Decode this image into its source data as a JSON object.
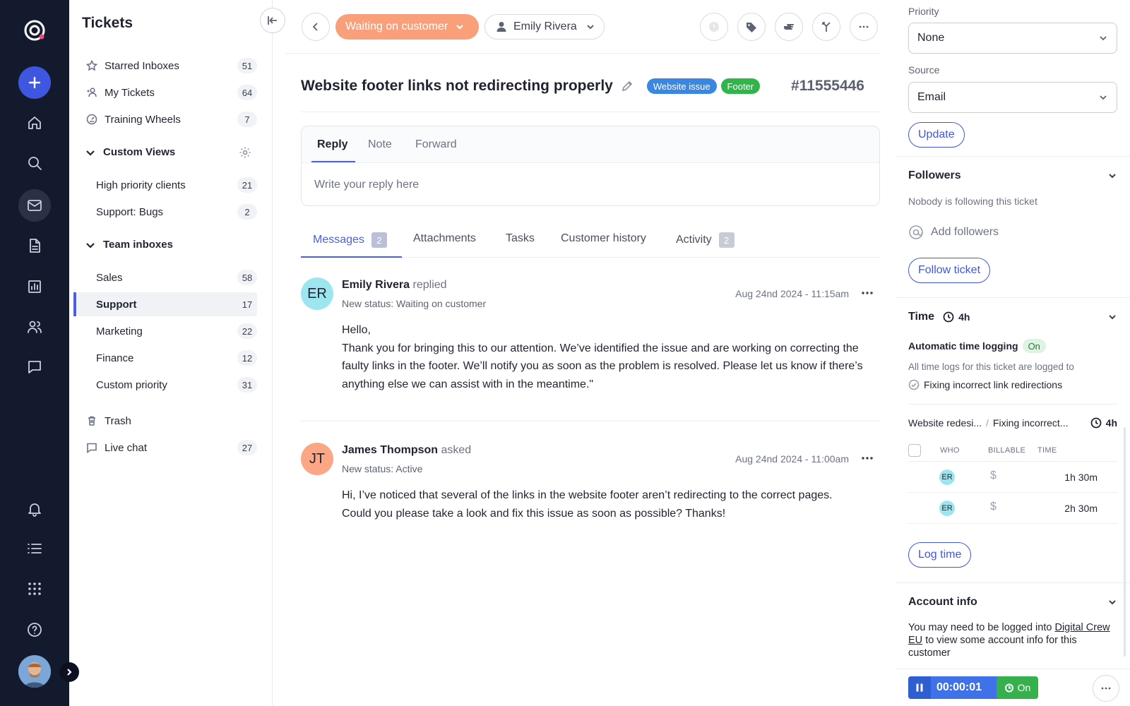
{
  "sidebar": {
    "title": "Tickets",
    "items": [
      {
        "label": "Starred Inboxes",
        "count": "51",
        "icon": "star-icon"
      },
      {
        "label": "My Tickets",
        "count": "64",
        "icon": "user-icon"
      },
      {
        "label": "Training Wheels",
        "count": "7",
        "icon": "gauge-icon"
      }
    ],
    "custom_views": {
      "label": "Custom Views",
      "items": [
        {
          "label": "High priority clients",
          "count": "21"
        },
        {
          "label": "Support: Bugs",
          "count": "2"
        }
      ]
    },
    "team_inboxes": {
      "label": "Team inboxes",
      "items": [
        {
          "label": "Sales",
          "count": "58"
        },
        {
          "label": "Support",
          "count": "17"
        },
        {
          "label": "Marketing",
          "count": "22"
        },
        {
          "label": "Finance",
          "count": "12"
        },
        {
          "label": "Custom priority",
          "count": "31"
        }
      ]
    },
    "bottom_items": [
      {
        "label": "Trash",
        "icon": "trash-icon"
      },
      {
        "label": "Live chat",
        "count": "27",
        "icon": "chat-icon"
      }
    ]
  },
  "topbar": {
    "status": "Waiting on customer",
    "assignee": "Emily Rivera"
  },
  "ticket": {
    "title": "Website footer links not redirecting properly",
    "tags": [
      "Website issue",
      "Footer"
    ],
    "id": "#11555446"
  },
  "reply": {
    "tabs": [
      "Reply",
      "Note",
      "Forward"
    ],
    "placeholder": "Write your reply here"
  },
  "message_tabs": [
    {
      "label": "Messages",
      "badge": "2"
    },
    {
      "label": "Attachments"
    },
    {
      "label": "Tasks"
    },
    {
      "label": "Customer history"
    },
    {
      "label": "Activity",
      "badge": "2"
    }
  ],
  "messages": [
    {
      "initials": "ER",
      "name": "Emily Rivera",
      "verb": "replied",
      "status": "New status: Waiting on customer",
      "date": "Aug 24nd 2024 - 11:15am",
      "body": [
        "Hello,",
        "Thank you for bringing this to our attention. We’ve identified the issue and are working on correcting the faulty links in the footer. We’ll notify you as soon as the problem is resolved. Please let us know if there’s anything else we can assist with in the meantime.\""
      ],
      "avatar_color": "#9ee6ef"
    },
    {
      "initials": "JT",
      "name": "James Thompson",
      "verb": "asked",
      "status": "New status: Active",
      "date": "Aug 24nd 2024 - 11:00am",
      "body": [
        "Hi, I’ve noticed that several of the links in the website footer aren’t redirecting to the correct pages. Could you please take a look and fix this issue as soon as possible? Thanks!"
      ],
      "avatar_color": "#fba786"
    }
  ],
  "right_panel": {
    "priority_label": "Priority",
    "priority_value": "None",
    "source_label": "Source",
    "source_value": "Email",
    "update_button": "Update",
    "followers": {
      "title": "Followers",
      "empty_text": "Nobody is following this ticket",
      "add_label": "Add followers",
      "follow_button": "Follow ticket"
    },
    "time": {
      "title": "Time",
      "total": "4h",
      "auto_logging_label": "Automatic time logging",
      "auto_logging_state": "On",
      "logged_to_text": "All time logs for this ticket are logged to",
      "task_name": "Fixing incorrect link redirections",
      "crumb_project": "Website redesi...",
      "crumb_task": "Fixing incorrect...",
      "crumb_total": "4h",
      "headers": [
        "WHO",
        "BILLABLE",
        "TIME"
      ],
      "rows": [
        {
          "who": "ER",
          "billable": "$",
          "time": "1h 30m"
        },
        {
          "who": "ER",
          "billable": "$",
          "time": "2h 30m"
        }
      ],
      "log_button": "Log time"
    },
    "account": {
      "title": "Account info",
      "text_before": "You may need to be logged into",
      "link": "Digital Crew EU",
      "text_after": "to view some account info for this customer"
    },
    "timer": {
      "value": "00:00:01",
      "state": "On"
    }
  }
}
